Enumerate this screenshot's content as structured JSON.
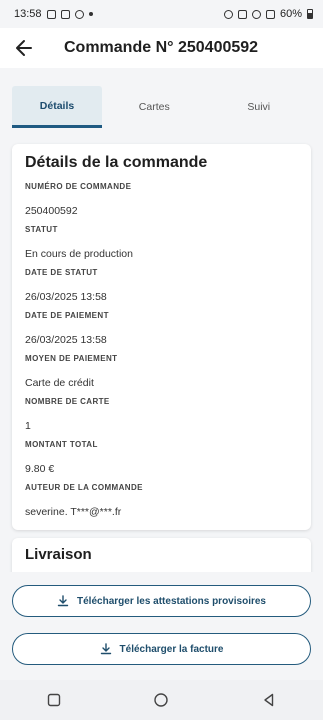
{
  "status_bar": {
    "time": "13:58",
    "battery": "60%"
  },
  "header": {
    "title": "Commande N° 250400592"
  },
  "tabs": [
    {
      "label": "Détails",
      "active": true
    },
    {
      "label": "Cartes",
      "active": false
    },
    {
      "label": "Suivi",
      "active": false
    }
  ],
  "details": {
    "title": "Détails de la commande",
    "fields": [
      {
        "label": "NUMÉRO DE COMMANDE",
        "value": "250400592"
      },
      {
        "label": "STATUT",
        "value": "En cours de production"
      },
      {
        "label": "DATE DE STATUT",
        "value": "26/03/2025 13:58"
      },
      {
        "label": "DATE DE PAIEMENT",
        "value": "26/03/2025 13:58"
      },
      {
        "label": "MOYEN DE PAIEMENT",
        "value": "Carte de crédit"
      },
      {
        "label": "NOMBRE DE CARTE",
        "value": "1"
      },
      {
        "label": "MONTANT TOTAL",
        "value": "9.80 €"
      },
      {
        "label": "AUTEUR DE LA COMMANDE",
        "value": "severine. T***@***.fr"
      }
    ]
  },
  "delivery": {
    "title": "Livraison"
  },
  "actions": {
    "download_certificates": "Télécharger les attestations provisoires",
    "download_invoice": "Télécharger la facture"
  },
  "colors": {
    "accent": "#1e5a82",
    "tab_active_bg": "#e2ebf0"
  }
}
